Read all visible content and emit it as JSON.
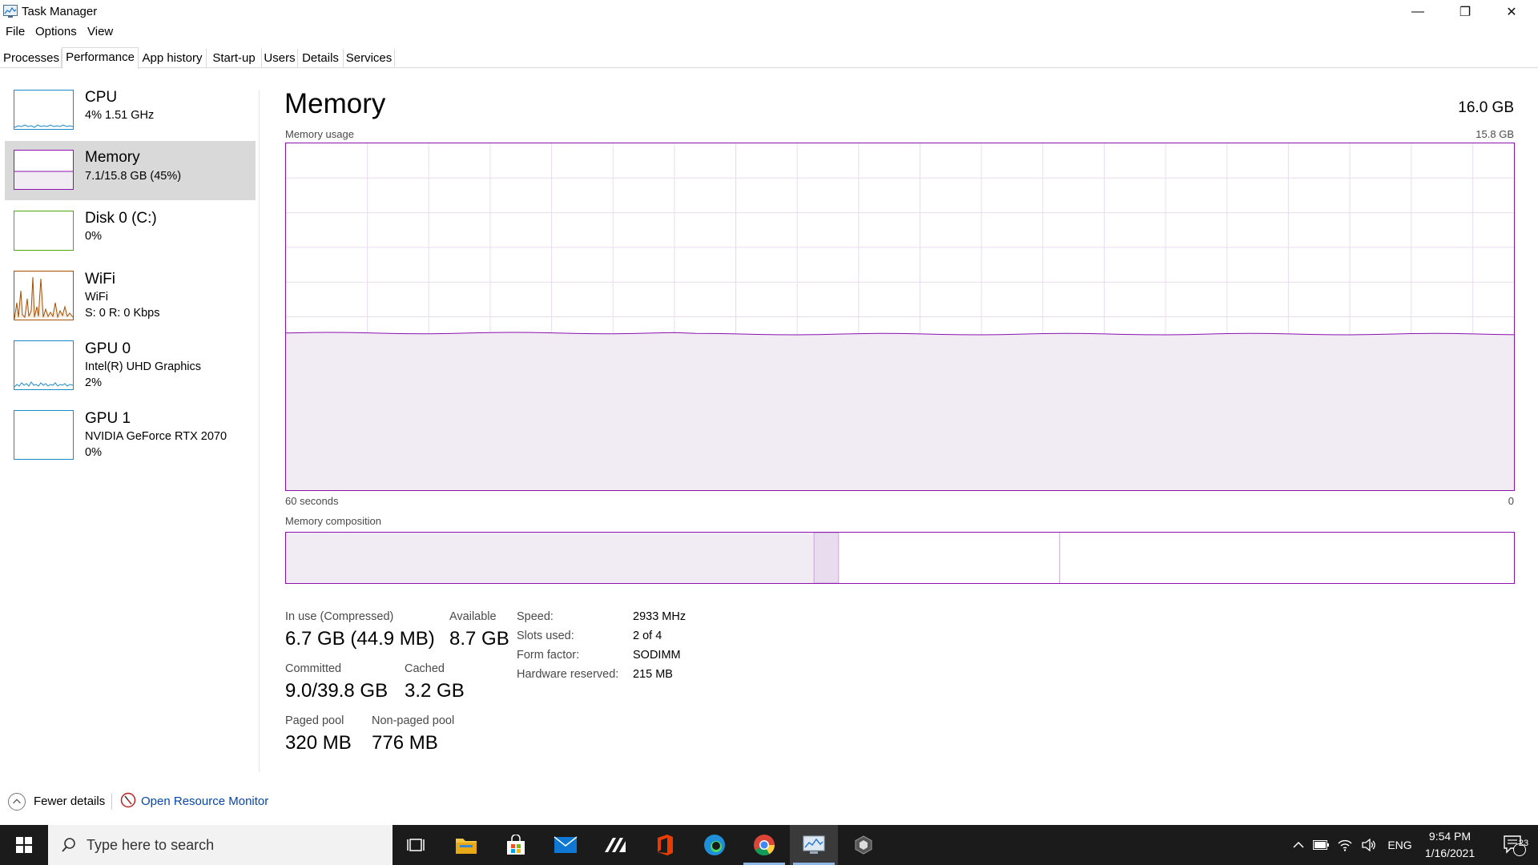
{
  "window": {
    "title": "Task Manager",
    "minimize_glyph": "—",
    "maximize_glyph": "❐",
    "close_glyph": "✕"
  },
  "menu": [
    "File",
    "Options",
    "View"
  ],
  "tabs": [
    "Processes",
    "Performance",
    "App history",
    "Start-up",
    "Users",
    "Details",
    "Services"
  ],
  "active_tab": "Performance",
  "sidebar": {
    "items": [
      {
        "name": "CPU",
        "line1": "4%  1.51 GHz",
        "line2": "",
        "color": "#1a8ac9"
      },
      {
        "name": "Memory",
        "line1": "7.1/15.8 GB (45%)",
        "line2": "",
        "color": "#8b12ae"
      },
      {
        "name": "Disk 0 (C:)",
        "line1": "0%",
        "line2": "",
        "color": "#4da60c"
      },
      {
        "name": "WiFi",
        "line1": "WiFi",
        "line2": "S: 0  R: 0 Kbps",
        "color": "#a74f01"
      },
      {
        "name": "GPU 0",
        "line1": "Intel(R) UHD Graphics",
        "line2": "2%",
        "color": "#1a8ac9"
      },
      {
        "name": "GPU 1",
        "line1": "NVIDIA GeForce RTX 2070",
        "line2": "0%",
        "color": "#1a8ac9"
      }
    ]
  },
  "main": {
    "title": "Memory",
    "total": "16.0 GB",
    "usage_label": "Memory usage",
    "usage_max": "15.8 GB",
    "time_label": "60 seconds",
    "time_zero": "0",
    "composition_label": "Memory composition",
    "usage_fraction": 0.45,
    "composition": {
      "in_use_fraction": 0.43,
      "modified_fraction": 0.02,
      "standby_fraction": 0.18
    }
  },
  "stats": {
    "in_use_label": "In use (Compressed)",
    "in_use_value": "6.7 GB (44.9 MB)",
    "available_label": "Available",
    "available_value": "8.7 GB",
    "committed_label": "Committed",
    "committed_value": "9.0/39.8 GB",
    "cached_label": "Cached",
    "cached_value": "3.2 GB",
    "paged_label": "Paged pool",
    "paged_value": "320 MB",
    "nonpaged_label": "Non-paged pool",
    "nonpaged_value": "776 MB"
  },
  "details": [
    {
      "label": "Speed:",
      "value": "2933 MHz"
    },
    {
      "label": "Slots used:",
      "value": "2 of 4"
    },
    {
      "label": "Form factor:",
      "value": "SODIMM"
    },
    {
      "label": "Hardware reserved:",
      "value": "215 MB"
    }
  ],
  "footer": {
    "fewer_details": "Fewer details",
    "open_resource_monitor": "Open Resource Monitor"
  },
  "taskbar": {
    "search_placeholder": "Type here to search",
    "language": "ENG",
    "time": "9:54 PM",
    "date": "1/16/2021",
    "notification_count": "23"
  },
  "colors": {
    "memory": "#8b12ae",
    "memory_fill": "#f1ecf4",
    "grid": "#eadcf0",
    "taskbar": "#1b1b1b"
  }
}
